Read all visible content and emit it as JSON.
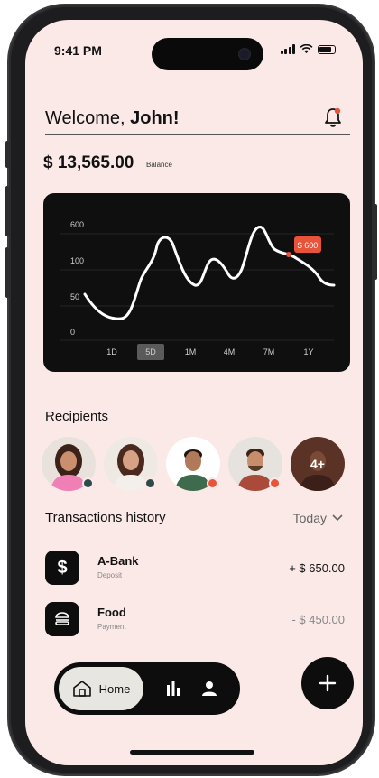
{
  "status": {
    "time": "9:41 PM"
  },
  "header": {
    "greeting": "Welcome, ",
    "user": "John!"
  },
  "balance": {
    "amount": "$ 13,565.00",
    "label": "Balance"
  },
  "chart_data": {
    "type": "line",
    "y_ticks": [
      "600",
      "100",
      "50",
      "0"
    ],
    "x": [
      "1D",
      "5D",
      "1M",
      "4M",
      "7M",
      "1Y"
    ],
    "selected_range": "5D",
    "tooltip": "$ 600",
    "line_color": "#ffffff",
    "tooltip_color": "#e8543a",
    "background": "#0f0f0f",
    "grid": true
  },
  "recipients": {
    "title": "Recipients",
    "more_label": "4+",
    "people": [
      {
        "name": "recipient-1",
        "status_color": "#2d4a4a"
      },
      {
        "name": "recipient-2",
        "status_color": "#2d4a4a"
      },
      {
        "name": "recipient-3",
        "status_color": "#e8543a"
      },
      {
        "name": "recipient-4",
        "status_color": "#e8543a"
      }
    ]
  },
  "transactions": {
    "title": "Transactions history",
    "filter": "Today",
    "items": [
      {
        "icon": "dollar-icon",
        "name": "A-Bank",
        "type": "Deposit",
        "amount": "+ $ 650.00"
      },
      {
        "icon": "burger-icon",
        "name": "Food",
        "type": "Payment",
        "amount": "- $ 450.00"
      }
    ]
  },
  "nav": {
    "home_label": "Home"
  },
  "colors": {
    "accent": "#e8543a",
    "screen_bg": "#fbe9e7",
    "dark": "#0d0d0d"
  }
}
